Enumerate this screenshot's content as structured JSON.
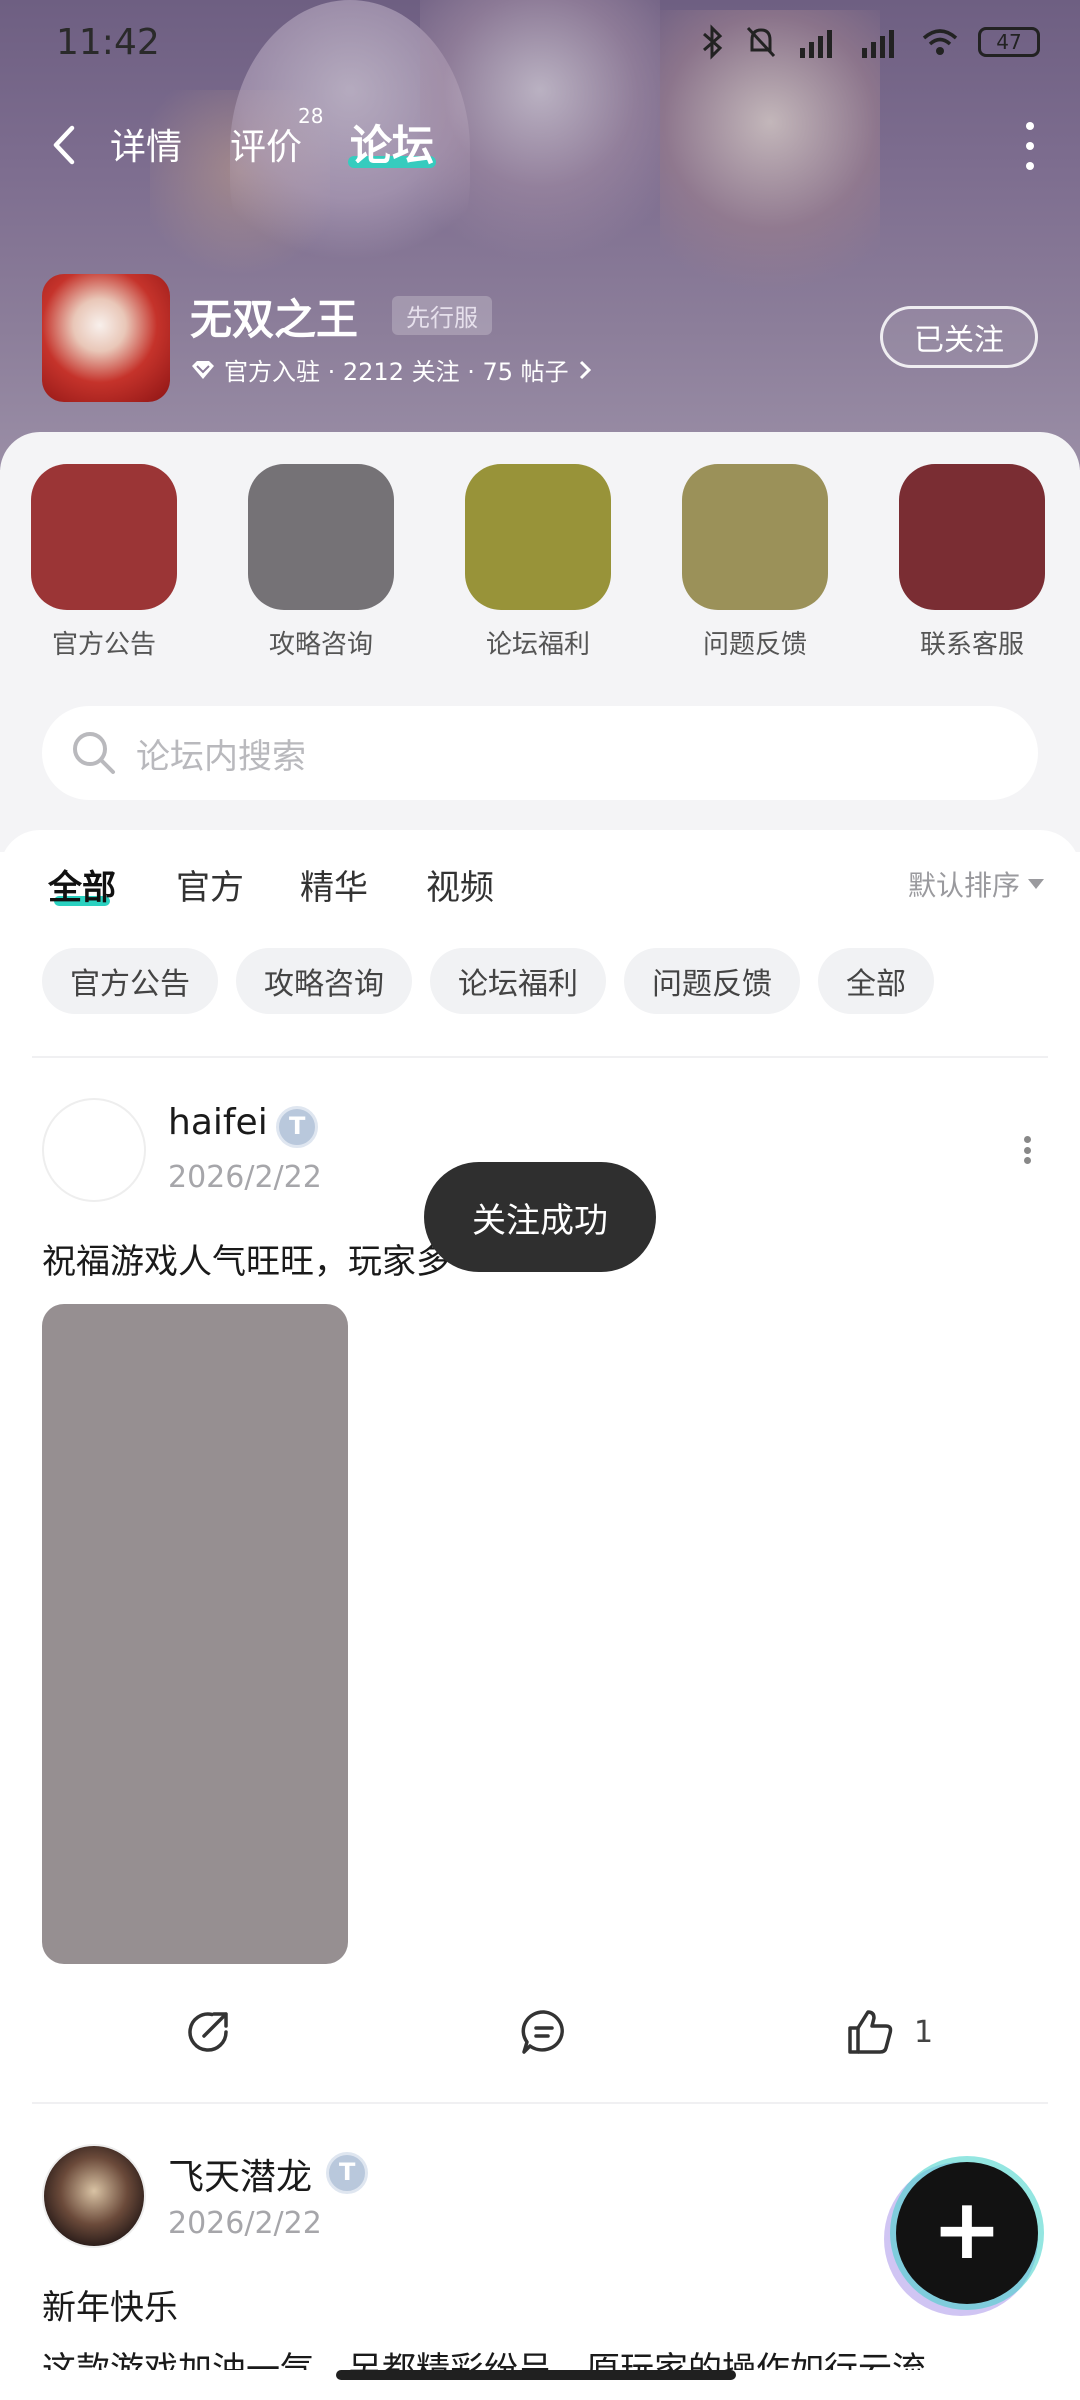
{
  "status_bar": {
    "time": "11:42",
    "battery": "47",
    "icons": [
      "bluetooth-icon",
      "mute-icon",
      "signal-hd-icon",
      "signal-hd-icon",
      "wifi-icon",
      "battery-icon"
    ]
  },
  "nav": {
    "tabs": [
      {
        "label": "详情"
      },
      {
        "label": "评价",
        "badge": "28"
      },
      {
        "label": "论坛",
        "active": true
      }
    ]
  },
  "game": {
    "name": "无双之王",
    "server_badge": "先行服",
    "meta": "官方入驻 · 2212 关注 · 75 帖子",
    "follow_label": "已关注"
  },
  "shortcuts": [
    {
      "label": "官方公告",
      "color": "#9b3536"
    },
    {
      "label": "攻略咨询",
      "color": "#757276"
    },
    {
      "label": "论坛福利",
      "color": "#989339"
    },
    {
      "label": "问题反馈",
      "color": "#9b9159"
    },
    {
      "label": "联系客服",
      "color": "#7a2d33"
    }
  ],
  "search": {
    "placeholder": "论坛内搜索"
  },
  "feed": {
    "tabs": [
      "全部",
      "官方",
      "精华",
      "视频"
    ],
    "sort_label": "默认排序",
    "chips": [
      "官方公告",
      "攻略咨询",
      "论坛福利",
      "问题反馈",
      "全部"
    ]
  },
  "posts": [
    {
      "author": "haifei",
      "date": "2026/2/22",
      "text": "祝福游戏人气旺旺，玩家多",
      "likes": "1"
    },
    {
      "author": "飞天潜龙",
      "date": "2026/2/22",
      "text": "新年快乐",
      "text2": "这款游戏加油一气，另都精彩纷呈，原玩家的操作如行云流"
    }
  ],
  "toast": "关注成功",
  "colors": {
    "accent": "#2ad1c0",
    "banner": "#7d6d8f",
    "toast_bg": "#2f2f2f"
  }
}
